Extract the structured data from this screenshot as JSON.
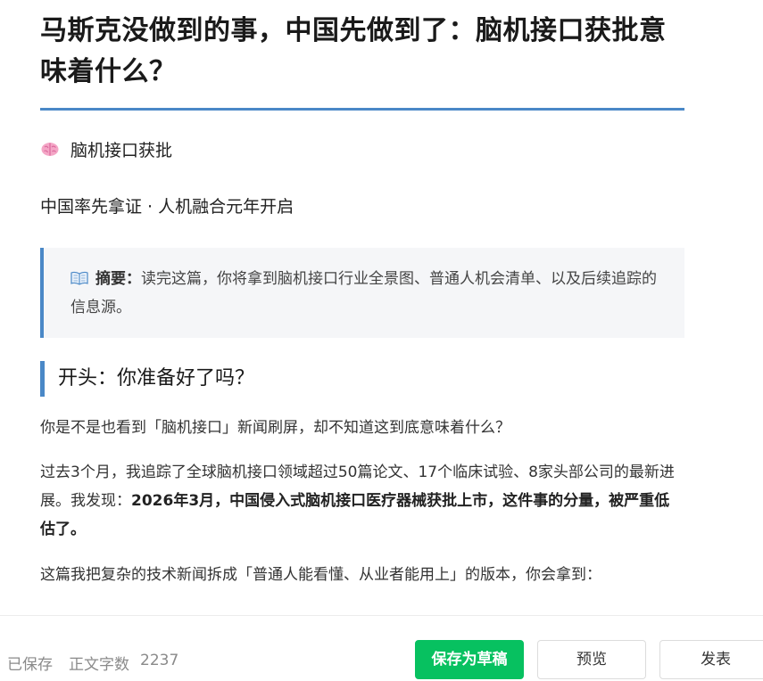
{
  "article": {
    "title": "马斯克没做到的事，中国先做到了：脑机接口获批意味着什么？",
    "tag": {
      "icon": "brain-icon",
      "label": "脑机接口获批"
    },
    "subtitle": "中国率先拿证 · 人机融合元年开启",
    "summary": {
      "icon": "open-book-icon",
      "label": "摘要：",
      "text": "读完这篇，你将拿到脑机接口行业全景图、普通人机会清单、以及后续追踪的信息源。"
    },
    "section_heading": "开头：你准备好了吗？",
    "paragraph1": "你是不是也看到「脑机接口」新闻刷屏，却不知道这到底意味着什么？",
    "paragraph2": {
      "text": "过去3个月，我追踪了全球脑机接口领域超过50篇论文、17个临床试验、8家头部公司的最新进展。我发现：",
      "bold": "2026年3月，中国侵入式脑机接口医疗器械获批上市，这件事的分量，被严重低估了。"
    },
    "paragraph3": "这篇我把复杂的技术新闻拆成「普通人能看懂、从业者能用上」的版本，你会拿到："
  },
  "bottom_bar": {
    "saved_status": "已保存",
    "word_count_label": "正文字数",
    "word_count": "2237",
    "save_draft_label": "保存为草稿",
    "preview_label": "预览",
    "publish_label": "发表"
  },
  "colors": {
    "accent_blue": "#4a88c7",
    "primary_green": "#07c160",
    "summary_bg": "#f5f6f8"
  }
}
